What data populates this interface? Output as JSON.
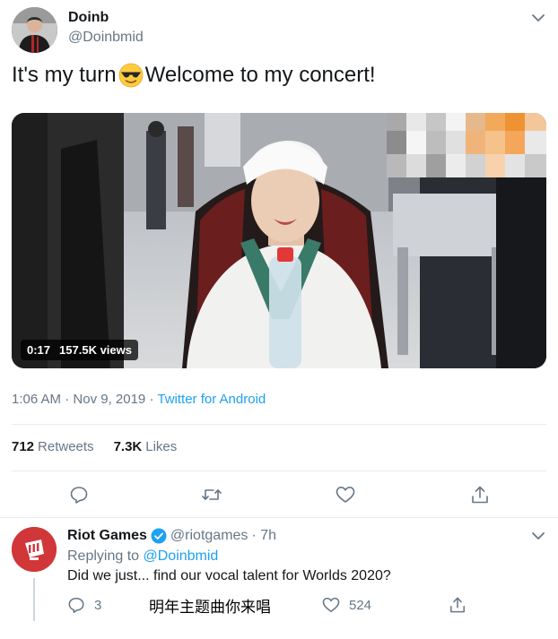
{
  "tweet": {
    "author_name": "Doinb",
    "author_handle": "@Doinbmid",
    "text_before_emoji": "It's my turn",
    "emoji": "smiling-face-with-sunglasses",
    "text_after_emoji": "Welcome to my concert!",
    "video": {
      "duration": "0:17",
      "views": "157.5K views"
    },
    "time": "1:06 AM",
    "date": "Nov 9, 2019",
    "separator": "·",
    "source": "Twitter for Android",
    "retweets_count": "712",
    "retweets_label": "Retweets",
    "likes_count": "7.3K",
    "likes_label": "Likes",
    "actions": [
      "reply-icon",
      "retweet-icon",
      "like-icon",
      "share-icon"
    ]
  },
  "reply": {
    "author_name": "Riot Games",
    "author_handle": "@riotgames",
    "age": "· 7h",
    "replying_prefix": "Replying to",
    "replying_to": "@Doinbmid",
    "text": "Did we just... find our vocal talent for Worlds 2020?",
    "reply_count": "3",
    "like_count": "524"
  },
  "overlay_caption": "明年主题曲你来唱",
  "colors": {
    "link": "#1da1f2",
    "secondary_text": "#657786",
    "primary_text": "#14171a",
    "riot_red": "#d13639",
    "divider": "#e6ecf0"
  }
}
